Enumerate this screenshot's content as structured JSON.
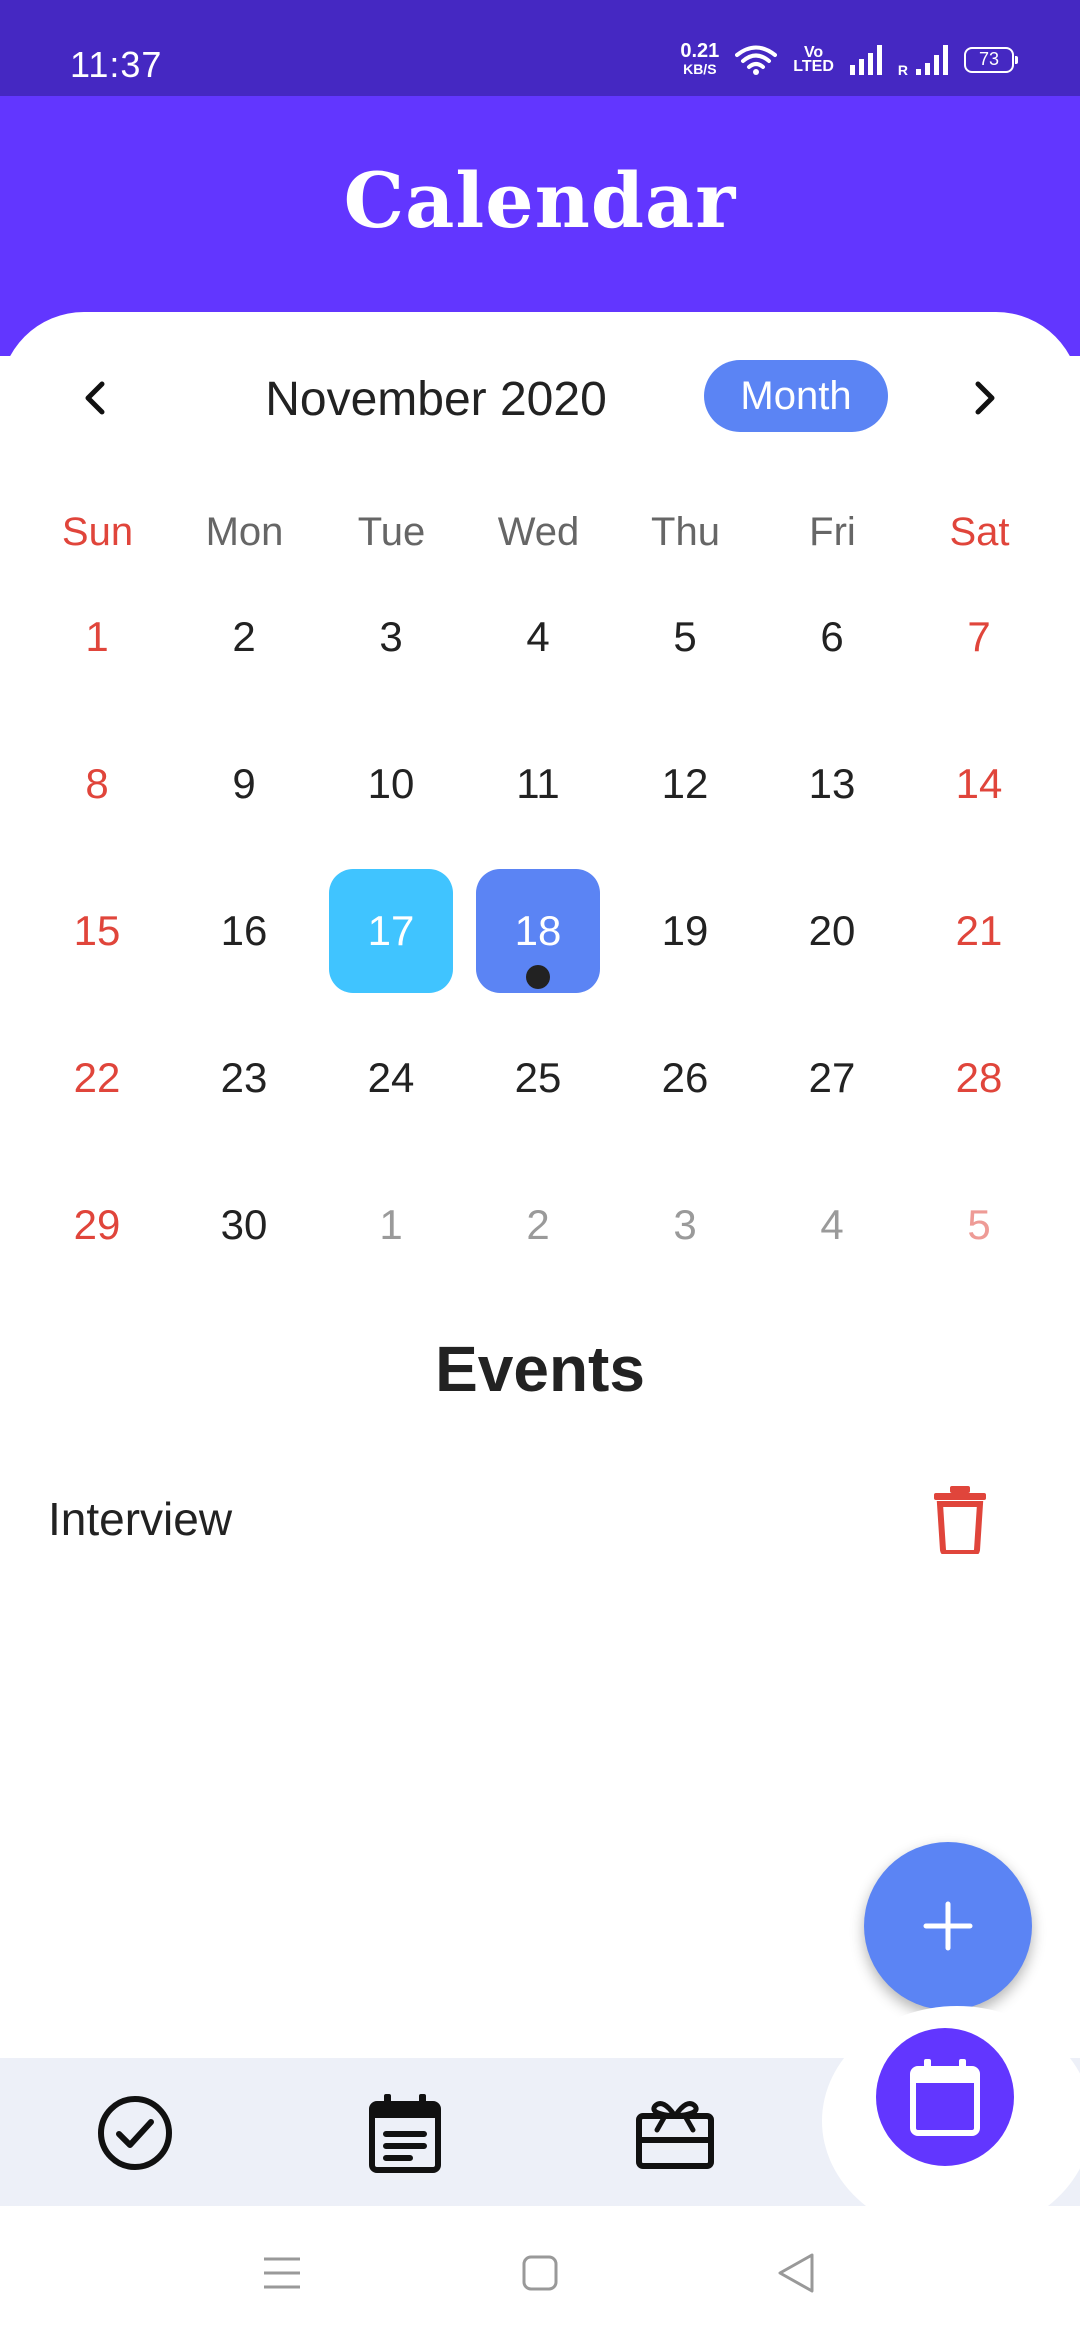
{
  "status_bar": {
    "time": "11:37",
    "net_speed_value": "0.21",
    "net_speed_unit": "KB/S",
    "volte_top": "Vo",
    "volte_bottom": "LTED",
    "roaming_label": "R",
    "battery_percent": "73"
  },
  "header": {
    "title": "Calendar"
  },
  "calendar": {
    "month_title": "November 2020",
    "format_button": "Month",
    "prev_icon": "chevron-left-icon",
    "next_icon": "chevron-right-icon",
    "weekdays": [
      "Sun",
      "Mon",
      "Tue",
      "Wed",
      "Thu",
      "Fri",
      "Sat"
    ],
    "weeks": [
      [
        "1",
        "2",
        "3",
        "4",
        "5",
        "6",
        "7"
      ],
      [
        "8",
        "9",
        "10",
        "11",
        "12",
        "13",
        "14"
      ],
      [
        "15",
        "16",
        "17",
        "18",
        "19",
        "20",
        "21"
      ],
      [
        "22",
        "23",
        "24",
        "25",
        "26",
        "27",
        "28"
      ],
      [
        "29",
        "30",
        "1",
        "2",
        "3",
        "4",
        "5"
      ]
    ],
    "today": "17",
    "selected": "18",
    "event_marker_on": "18",
    "next_month_days_start_index": 2,
    "colors": {
      "weekend": "#e0453b",
      "today_bg": "#40c4ff",
      "selected_bg": "#5b84f4",
      "header_bg": "#6236ff",
      "status_bg": "#4528c2"
    }
  },
  "events": {
    "title": "Events",
    "items": [
      {
        "name": "Interview",
        "action_icon": "trash-icon"
      }
    ]
  },
  "fab": {
    "icon": "plus-icon"
  },
  "bottom_nav": {
    "items": [
      {
        "icon": "check-circle-icon"
      },
      {
        "icon": "event-note-icon"
      },
      {
        "icon": "gift-card-icon"
      }
    ],
    "active_icon": "calendar-icon"
  },
  "system_nav": {
    "items": [
      "menu-icon",
      "home-icon",
      "back-icon"
    ]
  }
}
